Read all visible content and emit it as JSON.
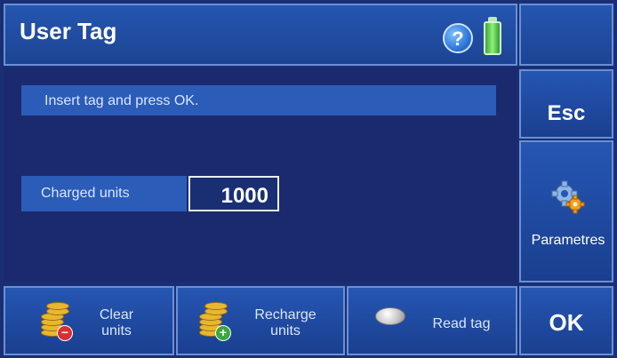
{
  "header": {
    "title": "User Tag",
    "help_glyph": "?"
  },
  "message": "Insert tag and press OK.",
  "charged": {
    "label": "Charged units",
    "value": "1000"
  },
  "side": {
    "esc_label": "Esc",
    "params_label": "Parametres",
    "ok_label": "OK"
  },
  "bottom": {
    "clear": {
      "line1": "Clear",
      "line2": "units"
    },
    "recharge": {
      "line1": "Recharge",
      "line2": "units"
    },
    "read_tag": "Read tag"
  },
  "icons": [
    "help-icon",
    "battery-icon",
    "gears-icon",
    "coins-remove-icon",
    "coins-add-icon",
    "tag-icon"
  ],
  "colors": {
    "background": "#1a2f73",
    "panel": "#2556b3",
    "accent_border": "#6a8fd6",
    "battery": "#38a836"
  }
}
